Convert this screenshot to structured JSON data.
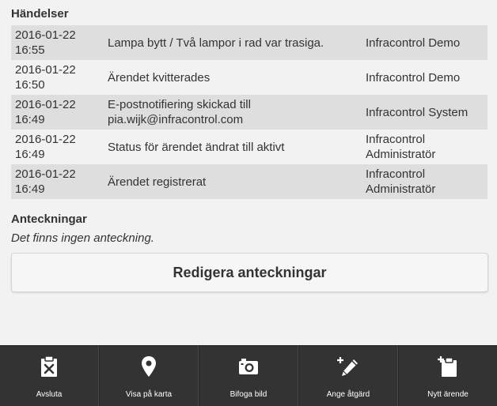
{
  "events": {
    "title": "Händelser",
    "rows": [
      {
        "date": "2016-01-22",
        "time": "16:55",
        "message": "Lampa bytt / Två lampor i rad var trasiga.",
        "user": "Infracontrol Demo"
      },
      {
        "date": "2016-01-22",
        "time": "16:50",
        "message": "Ärendet kvitterades",
        "user": "Infracontrol Demo"
      },
      {
        "date": "2016-01-22",
        "time": "16:49",
        "message": "E-postnotifiering skickad till pia.wijk@infracontrol.com",
        "user": "Infracontrol System"
      },
      {
        "date": "2016-01-22",
        "time": "16:49",
        "message": "Status för ärendet ändrat till aktivt",
        "user": "Infracontrol Administratör"
      },
      {
        "date": "2016-01-22",
        "time": "16:49",
        "message": "Ärendet registrerat",
        "user": "Infracontrol Administratör"
      }
    ]
  },
  "notes": {
    "title": "Anteckningar",
    "empty_text": "Det finns ingen anteckning.",
    "edit_button": "Redigera anteckningar"
  },
  "toolbar": {
    "items": [
      {
        "label": "Avsluta",
        "icon": "clipboard-x-icon"
      },
      {
        "label": "Visa på karta",
        "icon": "map-pin-icon"
      },
      {
        "label": "Bifoga bild",
        "icon": "camera-icon"
      },
      {
        "label": "Ange åtgärd",
        "icon": "pencil-plus-icon"
      },
      {
        "label": "Nytt ärende",
        "icon": "clipboard-plus-icon"
      }
    ]
  },
  "colors": {
    "toolbar_bg": "#333333",
    "row_alt": "#dedede",
    "page_bg": "#f2f2f2"
  }
}
